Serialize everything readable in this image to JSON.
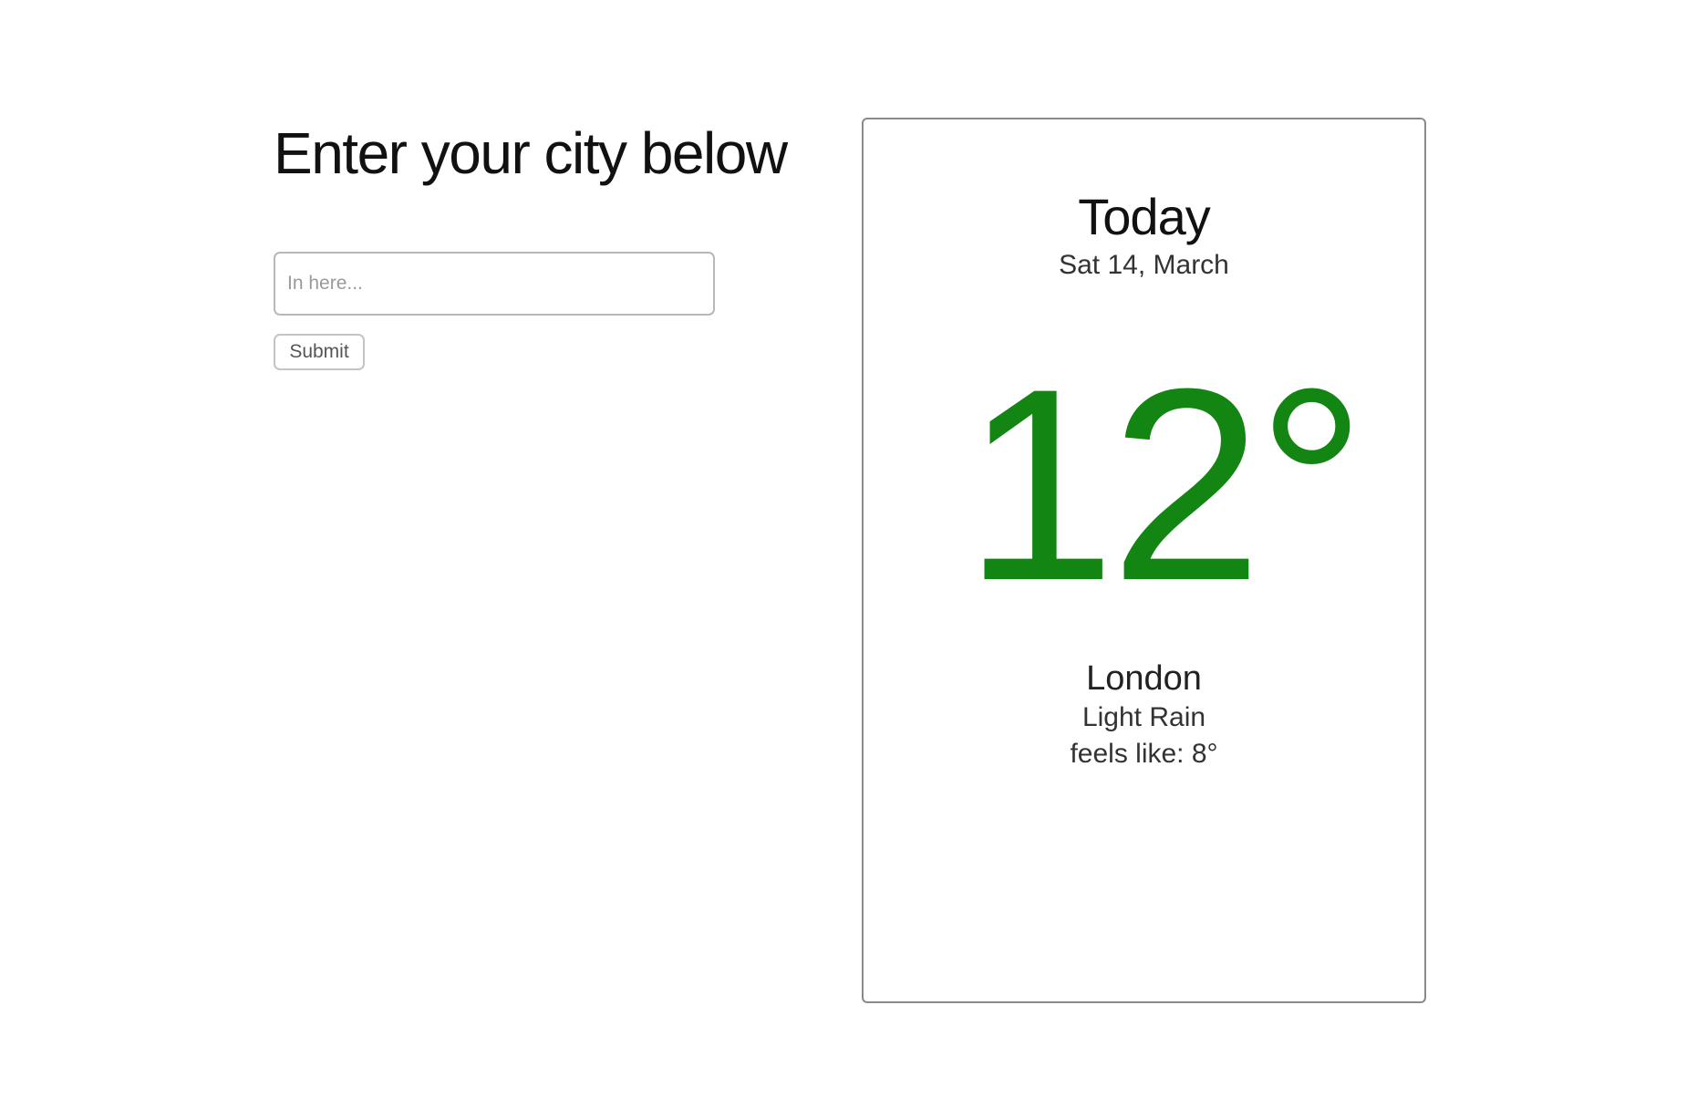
{
  "form": {
    "heading": "Enter your city below",
    "input_placeholder": "In here...",
    "input_value": "",
    "submit_label": "Submit"
  },
  "weather": {
    "title": "Today",
    "date": "Sat 14, March",
    "temperature": "12°",
    "city": "London",
    "condition": "Light Rain",
    "feels_like": "feels like: 8°"
  },
  "colors": {
    "temperature": "#138513",
    "card_border": "#8a8a8a",
    "input_border": "#b8b8b8"
  }
}
